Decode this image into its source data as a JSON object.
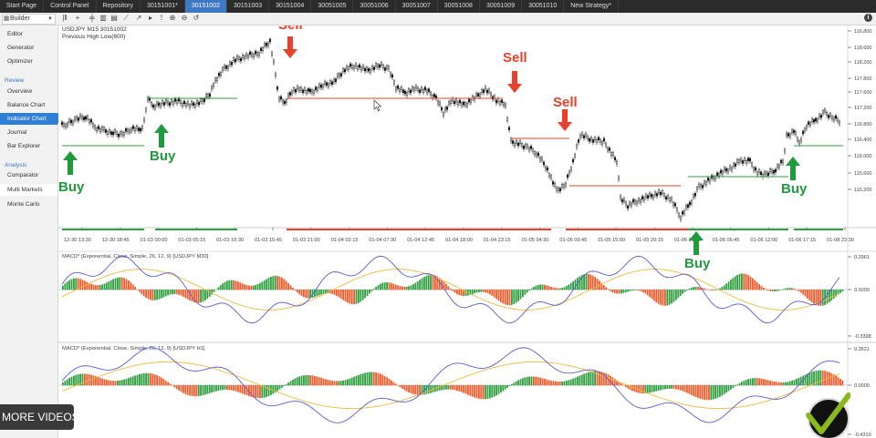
{
  "tabs": [
    {
      "label": "Start Page",
      "active": false
    },
    {
      "label": "Control Panel",
      "active": false
    },
    {
      "label": "Repository",
      "active": false
    },
    {
      "label": "30151001*",
      "active": false
    },
    {
      "label": "30151002",
      "active": true
    },
    {
      "label": "30151003",
      "active": false
    },
    {
      "label": "30151004",
      "active": false
    },
    {
      "label": "30051005",
      "active": false
    },
    {
      "label": "30051006",
      "active": false
    },
    {
      "label": "30051007",
      "active": false
    },
    {
      "label": "30051008",
      "active": false
    },
    {
      "label": "30051009",
      "active": false
    },
    {
      "label": "30051010",
      "active": false
    },
    {
      "label": "New Strategy*",
      "active": false
    }
  ],
  "toolbar": {
    "mode_label": "Builder",
    "info_icon": "i"
  },
  "sidebar": {
    "top_items": [
      "Editor",
      "Generator",
      "Optimizer"
    ],
    "review_label": "Review",
    "review_items": [
      "Overview",
      "Balance Chart",
      "Indicator Chart",
      "Journal",
      "Bar Explorer"
    ],
    "active_item": "Indicator Chart",
    "analysis_label": "Analysis",
    "analysis_items": [
      "Comparator",
      "Multi Markets",
      "Monte Carlo"
    ]
  },
  "chart": {
    "symbol_line": "USDJPY  M15 30151002",
    "indicator_line": "Previous High Low(800)",
    "price_ticks": [
      "116.800",
      "118.600",
      "118.200",
      "117.800",
      "117.600",
      "117.200",
      "116.800",
      "116.400",
      "116.000",
      "115.600",
      "115.200"
    ],
    "time_ticks": [
      "12-30 13:30",
      "12-30 18:45",
      "01-03 00:00",
      "01-03 05:15",
      "01-03 10:30",
      "01-03 15:45",
      "01-03 21:00",
      "01-04 02:15",
      "01-04 07:30",
      "01-04 12:45",
      "01-04 18:00",
      "01-04 23:15",
      "01-05 04:30",
      "01-05 09:45",
      "01-05 15:00",
      "01-05 20:15",
      "01-06 01:30",
      "01-06 06:45",
      "01-06 12:00",
      "01-06 17:15",
      "01-08 22:30"
    ],
    "macd1_title": "MACD* (Exponential, Close, Simple, 26, 12, 9) [USDJPY M30]",
    "macd1_ticks": [
      "0.2961",
      "0.0000",
      "-0.3398"
    ],
    "macd2_title": "MACD* (Exponential, Close, Simple, 26, 12, 9) [USDJPY H1]",
    "macd2_ticks": [
      "0.3521",
      "0.0000",
      "-0.4310"
    ]
  },
  "signals": [
    {
      "label": "Buy",
      "dir": "buy"
    },
    {
      "label": "Buy",
      "dir": "buy"
    },
    {
      "label": "Sell",
      "dir": "sell"
    },
    {
      "label": "Sell",
      "dir": "sell"
    },
    {
      "label": "Sell",
      "dir": "sell"
    },
    {
      "label": "Buy",
      "dir": "buy"
    },
    {
      "label": "Buy",
      "dir": "buy"
    }
  ],
  "colors": {
    "buy": "#1f9a3c",
    "sell": "#e8402a",
    "macd_pos": "#2e9e3e",
    "macd_neg": "#f25a2a",
    "macd_line": "#5b5bd6",
    "signal_line": "#f2b93b"
  },
  "more_videos": "MORE VIDEOS"
}
